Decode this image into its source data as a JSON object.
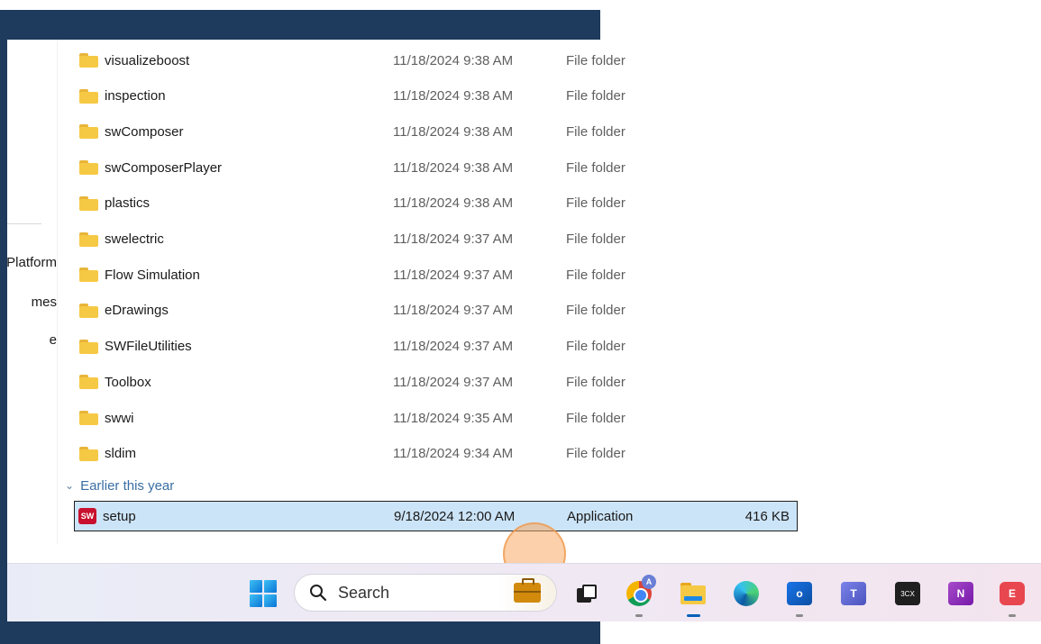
{
  "nav_pane": {
    "items": [
      "Platform",
      "mes",
      "e"
    ]
  },
  "files": [
    {
      "name": "visualizeboost",
      "date": "11/18/2024 9:38 AM",
      "type": "File folder"
    },
    {
      "name": "inspection",
      "date": "11/18/2024 9:38 AM",
      "type": "File folder"
    },
    {
      "name": "swComposer",
      "date": "11/18/2024 9:38 AM",
      "type": "File folder"
    },
    {
      "name": "swComposerPlayer",
      "date": "11/18/2024 9:38 AM",
      "type": "File folder"
    },
    {
      "name": "plastics",
      "date": "11/18/2024 9:38 AM",
      "type": "File folder"
    },
    {
      "name": "swelectric",
      "date": "11/18/2024 9:37 AM",
      "type": "File folder"
    },
    {
      "name": "Flow Simulation",
      "date": "11/18/2024 9:37 AM",
      "type": "File folder"
    },
    {
      "name": "eDrawings",
      "date": "11/18/2024 9:37 AM",
      "type": "File folder"
    },
    {
      "name": "SWFileUtilities",
      "date": "11/18/2024 9:37 AM",
      "type": "File folder"
    },
    {
      "name": "Toolbox",
      "date": "11/18/2024 9:37 AM",
      "type": "File folder"
    },
    {
      "name": "swwi",
      "date": "11/18/2024 9:35 AM",
      "type": "File folder"
    },
    {
      "name": "sldim",
      "date": "11/18/2024 9:34 AM",
      "type": "File folder"
    }
  ],
  "group": {
    "label": "Earlier this year"
  },
  "selected_file": {
    "name": "setup",
    "date": "9/18/2024 12:00 AM",
    "type": "Application",
    "size": "416 KB",
    "icon": "solidworks-icon",
    "icon_text": "SW"
  },
  "taskbar": {
    "search_label": "Search",
    "chrome_badge": "A",
    "outlook_letter": "o",
    "teams_letter": "T",
    "threecx_label": "3CX",
    "onenote_letter": "N",
    "redapp_letter": "E"
  },
  "colors": {
    "frame": "#1e3a5c",
    "selection": "#cce4f7",
    "accent": "#005fb8",
    "click_marker": "#f8aa64"
  }
}
